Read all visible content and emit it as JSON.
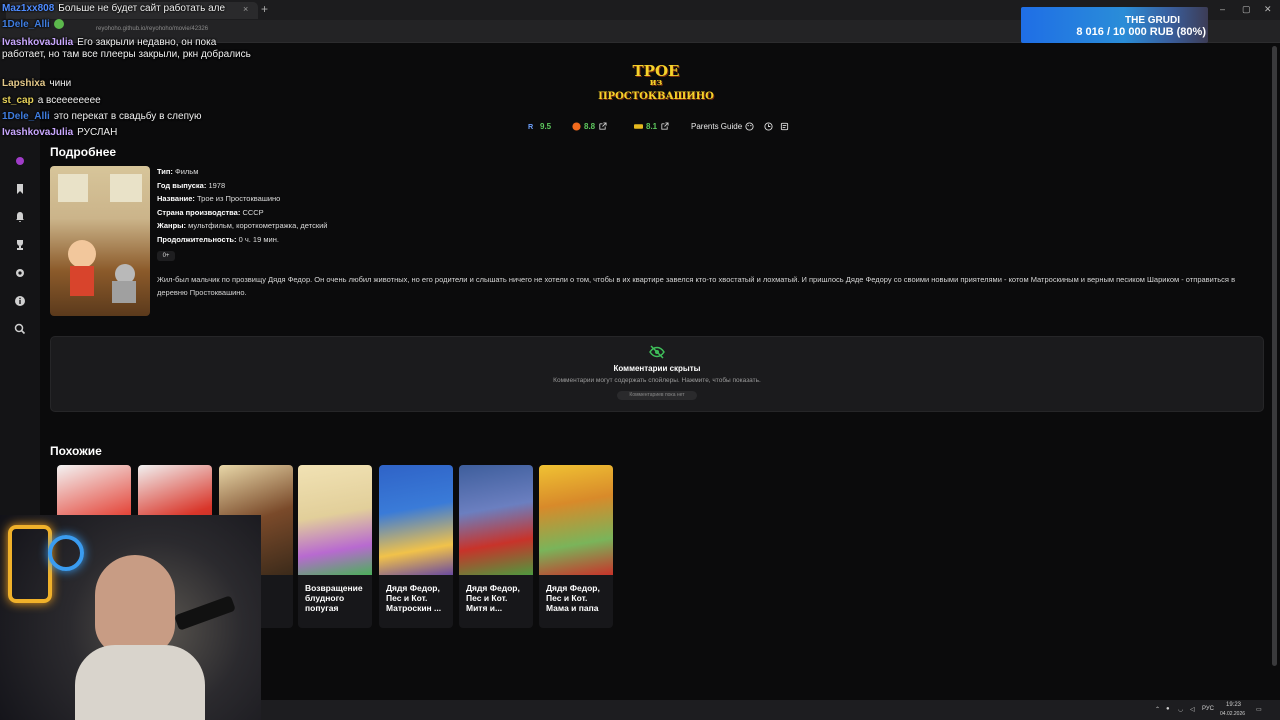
{
  "browser": {
    "tab_close": "×",
    "tab_add": "+",
    "url": "reyohoho.github.io/reyohoho/movie/42326",
    "window_controls": [
      "–",
      "▢",
      "✕"
    ]
  },
  "chat": [
    {
      "user": "Maz1xx808",
      "user_color": "#4f8cff",
      "text": "Больше не будет сайт работать але"
    },
    {
      "user": "1Dele_Alli",
      "user_color": "#3f7de0",
      "text": ""
    },
    {
      "user": "IvashkovaJulia",
      "user_color": "#c9a7ff",
      "text": "Его закрыли недавно, он пока работает, но там все плееры закрыли, ркн добрались"
    },
    {
      "user": "Lapshixa",
      "user_color": "#e3c88a",
      "text": "чини"
    },
    {
      "user": "st_cap",
      "user_color": "#e8d35a",
      "text": "а всееееееее"
    },
    {
      "user": "1Dele_Alli",
      "user_color": "#3f7de0",
      "text": "это перекат в свадьбу в слепую"
    },
    {
      "user": "IvashkovaJulia",
      "user_color": "#c9a7ff",
      "text": "РУСЛАН"
    }
  ],
  "donation": {
    "title": "THE GRUDI",
    "amount": "8 016 / 10 000 RUB (80%)"
  },
  "movie": {
    "logo_line1": "ТРОЕ",
    "logo_line2": "из",
    "logo_line3": "ПРОСТОКВАШИНО",
    "ratings": {
      "rating1": "9.5",
      "rating2": "8.8",
      "rating3": "8.1",
      "parents_guide": "Parents Guide"
    },
    "details_title": "Подробнее",
    "info": {
      "type_label": "Тип:",
      "type_value": "Фильм",
      "year_label": "Год выпуска:",
      "year_value": "1978",
      "name_label": "Название:",
      "name_value": "Трое из Простоквашино",
      "country_label": "Страна производства:",
      "country_value": "СССР",
      "genres_label": "Жанры:",
      "genres_value": "мультфильм, короткометражка, детский",
      "duration_label": "Продолжительность:",
      "duration_value": "0 ч. 19 мин."
    },
    "age_rating": "0+",
    "description": "Жил-был мальчик по прозвищу Дядя Федор. Он очень любил животных, но его родители и слышать ничего не хотели о том, чтобы в их квартире завелся кто-то хвостатый и лохматый. И пришлось Дяде Федору со своими новыми приятелями - котом Матроскиным и верным песиком Шариком - отправиться в деревню Простоквашино."
  },
  "comments": {
    "title": "Комментарии скрыты",
    "subtitle": "Комментарии могут содержать спойлеры. Нажмите, чтобы показать.",
    "pill": "Комментариев пока нет"
  },
  "similar": {
    "title": "Похожие",
    "items": [
      {
        "title": "",
        "color": "#e4473b"
      },
      {
        "title": "",
        "color": "#d9362a"
      },
      {
        "title": "",
        "color": "#7a4a2a"
      },
      {
        "title": "Возвращение блудного попугая",
        "color": "#e2cf9a"
      },
      {
        "title": "Дядя Федор, Пес и Кот. Матроскин ...",
        "color": "#3a7bd8"
      },
      {
        "title": "Дядя Федор, Пес и Кот. Митя и...",
        "color": "#3e5e9c"
      },
      {
        "title": "Дядя Федор, Пес и Кот. Мама и папа",
        "color": "#d88a2a"
      }
    ]
  },
  "taskbar": {
    "lang": "РУС",
    "time": "19:23",
    "date": "04.02.2026"
  }
}
